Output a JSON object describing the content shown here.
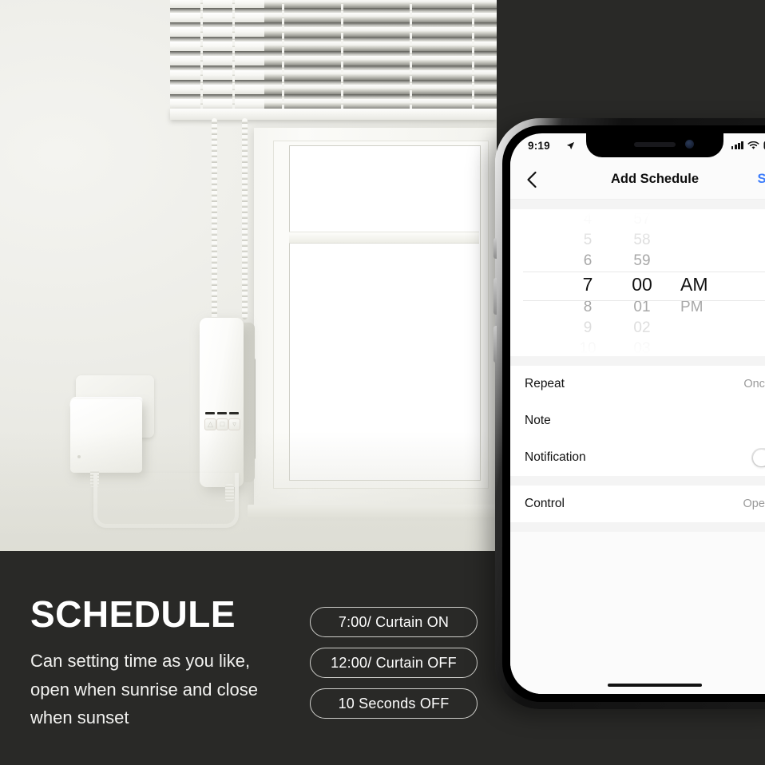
{
  "promo": {
    "heading": "SCHEDULE",
    "subcopy": "Can setting time as you like, open when sunrise and close when sunset",
    "pills": [
      "7:00/ Curtain ON",
      "12:00/ Curtain OFF",
      "10 Seconds OFF"
    ],
    "banner_bg": "#292927",
    "text_color": "#ffffff"
  },
  "scene": {
    "wall_color": "#eeeee8",
    "blind_color": "#f2f2ee",
    "device_names": [
      "power-adapter",
      "curtain-motor",
      "window-blinds",
      "usb-cable"
    ],
    "motor_buttons": [
      "up",
      "stop",
      "down"
    ]
  },
  "phone": {
    "statusbar": {
      "time": "9:19",
      "location_icon": "location-arrow-icon",
      "cellular_icon": "cellular-bars-icon",
      "wifi_icon": "wifi-icon",
      "battery_icon": "battery-icon"
    },
    "navbar": {
      "back_icon": "chevron-left-icon",
      "title": "Add Schedule",
      "save_label": "Save",
      "save_color": "#3d7dfb"
    },
    "picker": {
      "hours": [
        "4",
        "5",
        "6",
        "7",
        "8",
        "9",
        "10"
      ],
      "hour_selected": "7",
      "minutes": [
        "57",
        "58",
        "59",
        "00",
        "01",
        "02",
        "03"
      ],
      "minute_selected": "00",
      "meridiem": [
        "AM",
        "PM"
      ],
      "meridiem_selected": "AM"
    },
    "list": {
      "group1": [
        {
          "label": "Repeat",
          "value": "Once",
          "accessory": "chevron"
        },
        {
          "label": "Note",
          "value": "",
          "accessory": "chevron"
        },
        {
          "label": "Notification",
          "value": "",
          "accessory": "toggle",
          "toggle_on": false
        }
      ],
      "group2": [
        {
          "label": "Control",
          "value": "Open",
          "accessory": "chevron"
        }
      ]
    },
    "home_indicator": "home-indicator"
  }
}
